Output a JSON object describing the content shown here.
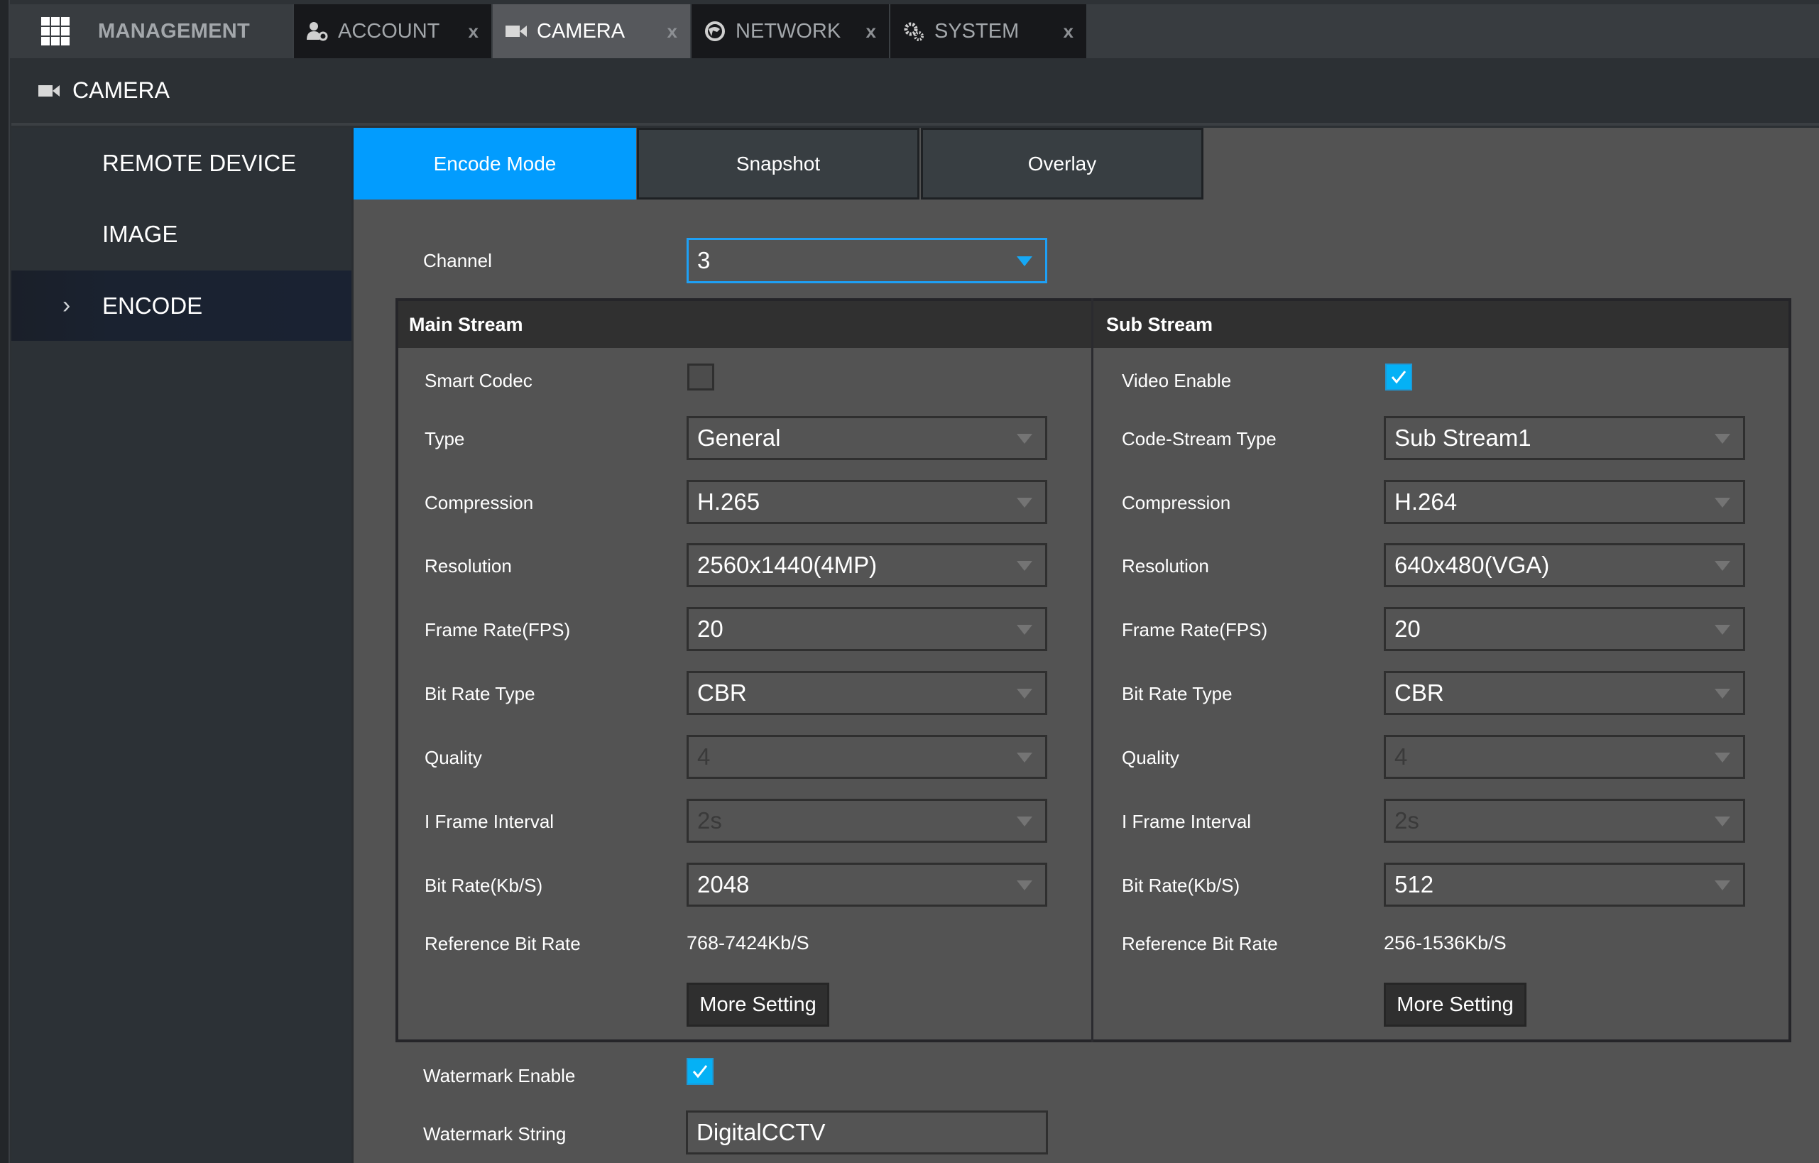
{
  "topbar": {
    "management_label": "MANAGEMENT",
    "tabs": [
      {
        "label": "ACCOUNT",
        "icon": "account-gear-icon",
        "close": "x",
        "active": false
      },
      {
        "label": "CAMERA",
        "icon": "camera-icon",
        "close": "x",
        "active": true
      },
      {
        "label": "NETWORK",
        "icon": "network-globe-icon",
        "close": "x",
        "active": false
      },
      {
        "label": "SYSTEM",
        "icon": "system-gears-icon",
        "close": "x",
        "active": false
      }
    ]
  },
  "header": {
    "title": "CAMERA",
    "icon": "camera-icon"
  },
  "sidebar": {
    "items": [
      {
        "label": "REMOTE DEVICE",
        "active": false
      },
      {
        "label": "IMAGE",
        "active": false
      },
      {
        "label": "ENCODE",
        "active": true,
        "chevron": "›"
      }
    ]
  },
  "subtabs": [
    {
      "label": "Encode Mode",
      "active": true
    },
    {
      "label": "Snapshot",
      "active": false
    },
    {
      "label": "Overlay",
      "active": false
    }
  ],
  "channel": {
    "label": "Channel",
    "value": "3"
  },
  "main_stream": {
    "title": "Main Stream",
    "smart_codec": {
      "label": "Smart Codec",
      "checked": false
    },
    "type": {
      "label": "Type",
      "value": "General"
    },
    "compression": {
      "label": "Compression",
      "value": "H.265"
    },
    "resolution": {
      "label": "Resolution",
      "value": "2560x1440(4MP)"
    },
    "frame_rate": {
      "label": "Frame Rate(FPS)",
      "value": "20"
    },
    "bit_rate_type": {
      "label": "Bit Rate Type",
      "value": "CBR"
    },
    "quality": {
      "label": "Quality",
      "value": "4",
      "disabled": true
    },
    "i_frame_interval": {
      "label": "I Frame Interval",
      "value": "2s",
      "disabled": true
    },
    "bit_rate": {
      "label": "Bit Rate(Kb/S)",
      "value": "2048"
    },
    "reference_bit_rate": {
      "label": "Reference Bit Rate",
      "value": "768-7424Kb/S"
    },
    "more_setting": "More Setting"
  },
  "sub_stream": {
    "title": "Sub Stream",
    "video_enable": {
      "label": "Video Enable",
      "checked": true
    },
    "code_stream_type": {
      "label": "Code-Stream Type",
      "value": "Sub Stream1"
    },
    "compression": {
      "label": "Compression",
      "value": "H.264"
    },
    "resolution": {
      "label": "Resolution",
      "value": "640x480(VGA)"
    },
    "frame_rate": {
      "label": "Frame Rate(FPS)",
      "value": "20"
    },
    "bit_rate_type": {
      "label": "Bit Rate Type",
      "value": "CBR"
    },
    "quality": {
      "label": "Quality",
      "value": "4",
      "disabled": true
    },
    "i_frame_interval": {
      "label": "I Frame Interval",
      "value": "2s",
      "disabled": true
    },
    "bit_rate": {
      "label": "Bit Rate(Kb/S)",
      "value": "512"
    },
    "reference_bit_rate": {
      "label": "Reference Bit Rate",
      "value": "256-1536Kb/S"
    },
    "more_setting": "More Setting"
  },
  "watermark": {
    "enable": {
      "label": "Watermark Enable",
      "checked": true
    },
    "string": {
      "label": "Watermark String",
      "value": "DigitalCCTV"
    }
  },
  "colors": {
    "accent": "#029cfe",
    "checkbox": "#05b1f5",
    "panel": "#535353",
    "sidebar_active": "#1a2232"
  }
}
